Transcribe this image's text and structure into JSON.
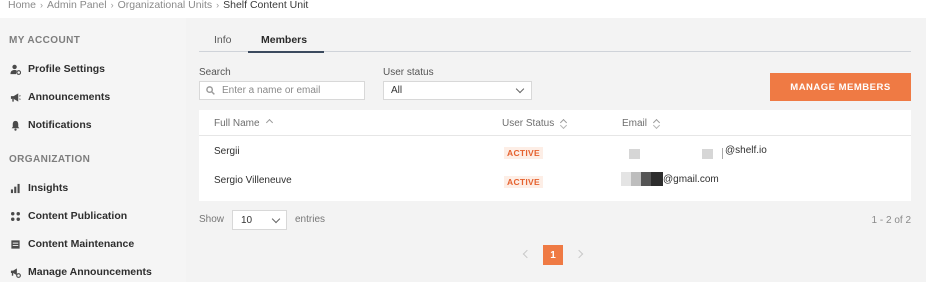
{
  "breadcrumb": {
    "items": [
      "Home",
      "Admin Panel",
      "Organizational Units"
    ],
    "current": "Shelf Content Unit",
    "separator": "›"
  },
  "sidebar": {
    "my_account_title": "MY ACCOUNT",
    "my_account_items": [
      {
        "label": "Profile Settings",
        "icon": "user-cog-icon"
      },
      {
        "label": "Announcements",
        "icon": "megaphone-icon"
      },
      {
        "label": "Notifications",
        "icon": "bell-icon"
      }
    ],
    "organization_title": "ORGANIZATION",
    "organization_items": [
      {
        "label": "Insights",
        "icon": "bar-chart-icon"
      },
      {
        "label": "Content Publication",
        "icon": "grid-dots-icon"
      },
      {
        "label": "Content Maintenance",
        "icon": "clipboard-icon"
      },
      {
        "label": "Manage Announcements",
        "icon": "megaphone-gear-icon"
      }
    ]
  },
  "tabs": {
    "info": "Info",
    "members": "Members",
    "active": "Members"
  },
  "filters": {
    "search_label": "Search",
    "search_placeholder": "Enter a name or email",
    "search_value": "",
    "status_label": "User status",
    "status_value": "All"
  },
  "manage_button": "MANAGE MEMBERS",
  "table": {
    "headers": {
      "full_name": "Full Name",
      "status": "User Status",
      "email": "Email"
    },
    "rows": [
      {
        "name": "Sergii",
        "status": "ACTIVE",
        "email_suffix": "@shelf.io"
      },
      {
        "name": "Sergio Villeneuve",
        "status": "ACTIVE",
        "email_suffix": "@gmail.com"
      }
    ]
  },
  "pagination": {
    "show_label": "Show",
    "entries_value": "10",
    "entries_label": "entries",
    "range": "1 - 2 of 2",
    "current_page": "1"
  },
  "colors": {
    "accent": "#ef7a44",
    "active_badge_text": "#e5612e",
    "tab_underline": "#3b4a5e"
  }
}
